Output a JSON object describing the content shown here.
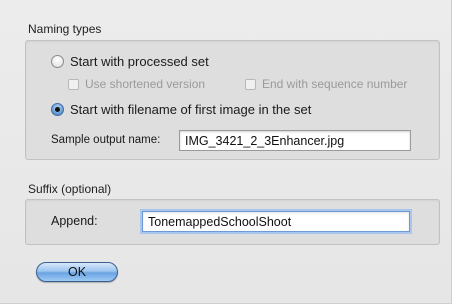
{
  "naming_types": {
    "title": "Naming types",
    "option_processed_set": {
      "label": "Start with processed set",
      "checked": false
    },
    "sub_options": {
      "use_shortened": {
        "label": "Use shortened version",
        "checked": false,
        "enabled": false
      },
      "end_with_sequence": {
        "label": "End with sequence number",
        "checked": false,
        "enabled": false
      }
    },
    "option_filename": {
      "label": "Start with filename of first image in the set",
      "checked": true
    },
    "sample_output": {
      "label": "Sample output name:",
      "value": "IMG_3421_2_3Enhancer.jpg"
    }
  },
  "suffix": {
    "title": "Suffix (optional)",
    "append": {
      "label": "Append:",
      "value": "TonemappedSchoolShoot"
    }
  },
  "buttons": {
    "ok_label": "OK"
  },
  "colors": {
    "accent": "#6aa3e2",
    "focus_ring": "#a9c7ee"
  }
}
